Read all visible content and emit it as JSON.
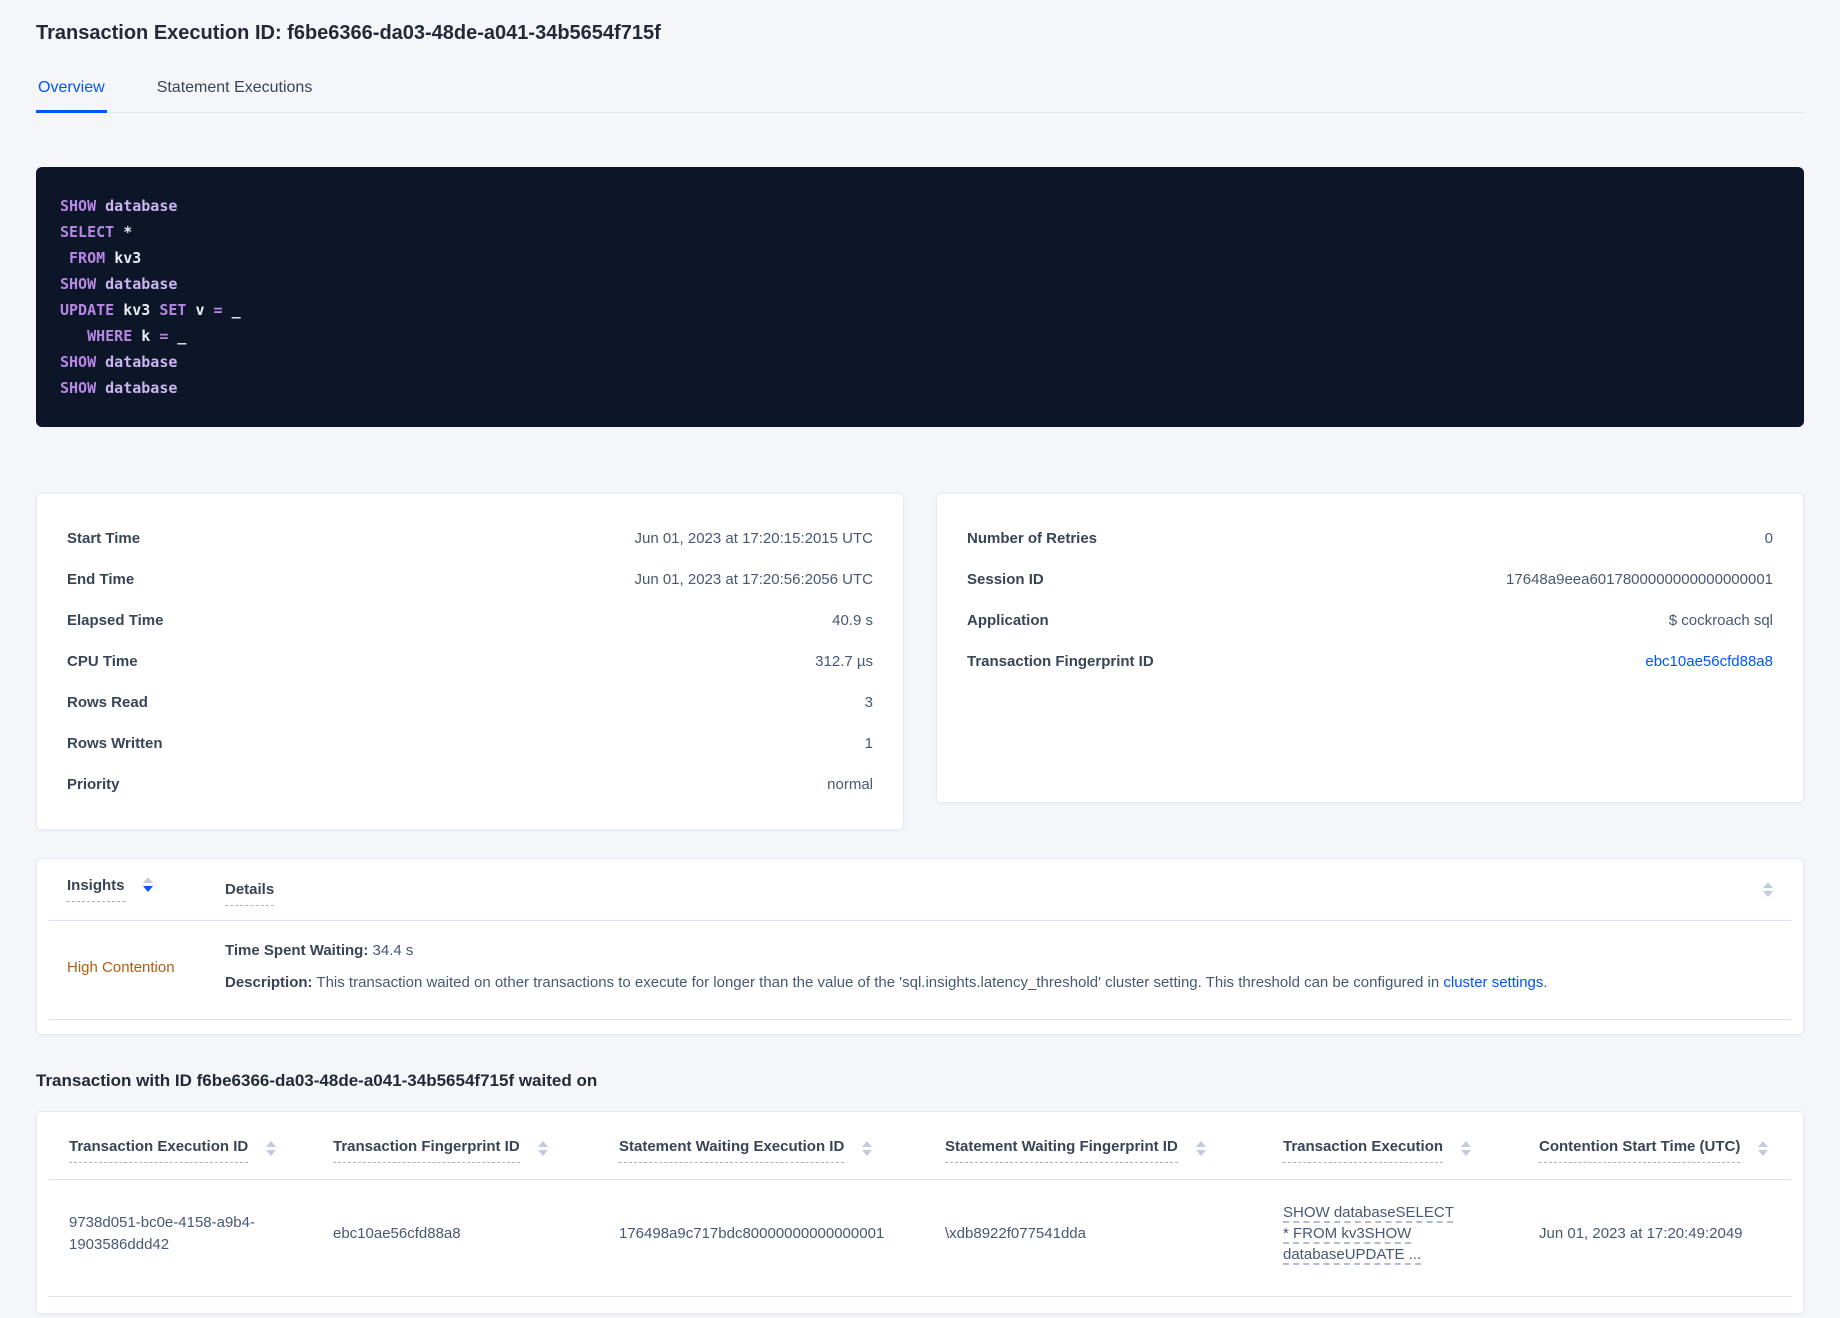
{
  "header": {
    "title": "Transaction Execution ID: f6be6366-da03-48de-a041-34b5654f715f",
    "tabs": [
      {
        "label": "Overview",
        "active": true
      },
      {
        "label": "Statement Executions",
        "active": false
      }
    ]
  },
  "sql": {
    "lines": [
      [
        {
          "t": "SHOW ",
          "c": "kw"
        },
        {
          "t": "database",
          "c": "id"
        }
      ],
      [
        {
          "t": "SELECT ",
          "c": "kw"
        },
        {
          "t": "*",
          "c": "pl"
        }
      ],
      [
        {
          "t": " FROM ",
          "c": "kw"
        },
        {
          "t": "kv3",
          "c": "pl"
        }
      ],
      [
        {
          "t": "SHOW ",
          "c": "kw"
        },
        {
          "t": "database",
          "c": "id"
        }
      ],
      [
        {
          "t": "UPDATE ",
          "c": "kw"
        },
        {
          "t": "kv3 ",
          "c": "pl"
        },
        {
          "t": "SET ",
          "c": "kw"
        },
        {
          "t": "v ",
          "c": "pl"
        },
        {
          "t": "= ",
          "c": "kw"
        },
        {
          "t": "_",
          "c": "pl"
        }
      ],
      [
        {
          "t": "   ",
          "c": "pl"
        },
        {
          "t": "WHERE ",
          "c": "kw"
        },
        {
          "t": "k ",
          "c": "pl"
        },
        {
          "t": "= ",
          "c": "kw"
        },
        {
          "t": "_",
          "c": "pl"
        }
      ],
      [
        {
          "t": "SHOW ",
          "c": "kw"
        },
        {
          "t": "database",
          "c": "id"
        }
      ],
      [
        {
          "t": "SHOW ",
          "c": "kw"
        },
        {
          "t": "database",
          "c": "id"
        }
      ]
    ]
  },
  "summary_left": {
    "rows": [
      {
        "label": "Start Time",
        "value": "Jun 01, 2023 at 17:20:15:2015 UTC"
      },
      {
        "label": "End Time",
        "value": "Jun 01, 2023 at 17:20:56:2056 UTC"
      },
      {
        "label": "Elapsed Time",
        "value": "40.9 s"
      },
      {
        "label": "CPU Time",
        "value": "312.7 µs"
      },
      {
        "label": "Rows Read",
        "value": "3"
      },
      {
        "label": "Rows Written",
        "value": "1"
      },
      {
        "label": "Priority",
        "value": "normal"
      }
    ]
  },
  "summary_right": {
    "rows": [
      {
        "label": "Number of Retries",
        "value": "0"
      },
      {
        "label": "Session ID",
        "value": "17648a9eea6017800000000000000001"
      },
      {
        "label": "Application",
        "value": "$ cockroach sql"
      },
      {
        "label": "Transaction Fingerprint ID",
        "value": "ebc10ae56cfd88a8"
      }
    ]
  },
  "insights_table": {
    "col_insights": "Insights",
    "col_details": "Details",
    "row": {
      "insight": "High Contention",
      "waiting_label": "Time Spent Waiting:",
      "waiting_value": " 34.4 s",
      "description_label": "Description:",
      "description_text": " This transaction waited on other transactions to execute for longer than the value of the 'sql.insights.latency_threshold' cluster setting. This threshold can be configured in ",
      "description_link": "cluster settings",
      "description_suffix": "."
    }
  },
  "waited_section": {
    "heading": "Transaction with ID f6be6366-da03-48de-a041-34b5654f715f waited on",
    "columns": [
      "Transaction Execution ID",
      "Transaction Fingerprint ID",
      "Statement Waiting Execution ID",
      "Statement Waiting Fingerprint ID",
      "Transaction Execution",
      "Contention Start Time (UTC)"
    ],
    "rows": [
      {
        "transaction_execution_id": "9738d051-bc0e-4158-a9b4-1903586ddd42",
        "transaction_fingerprint_id": "ebc10ae56cfd88a8",
        "statement_waiting_execution_id": "176498a9c717bdc80000000000000001",
        "statement_waiting_fingerprint_id": "\\xdb8922f077541dda",
        "transaction_execution": "SHOW databaseSELECT * FROM kv3SHOW databaseUPDATE ...",
        "contention_start_time": "Jun 01, 2023 at 17:20:49:2049"
      }
    ]
  },
  "colors": {
    "accent_blue": "#0055ff",
    "insight_warning_orange": "#b45c0f",
    "code_background": "#0c1628",
    "code_keyword": "#b787e6",
    "code_identifier": "#cbb5f0",
    "code_plain": "#e8ecf5",
    "page_background": "#f4f6fa"
  }
}
